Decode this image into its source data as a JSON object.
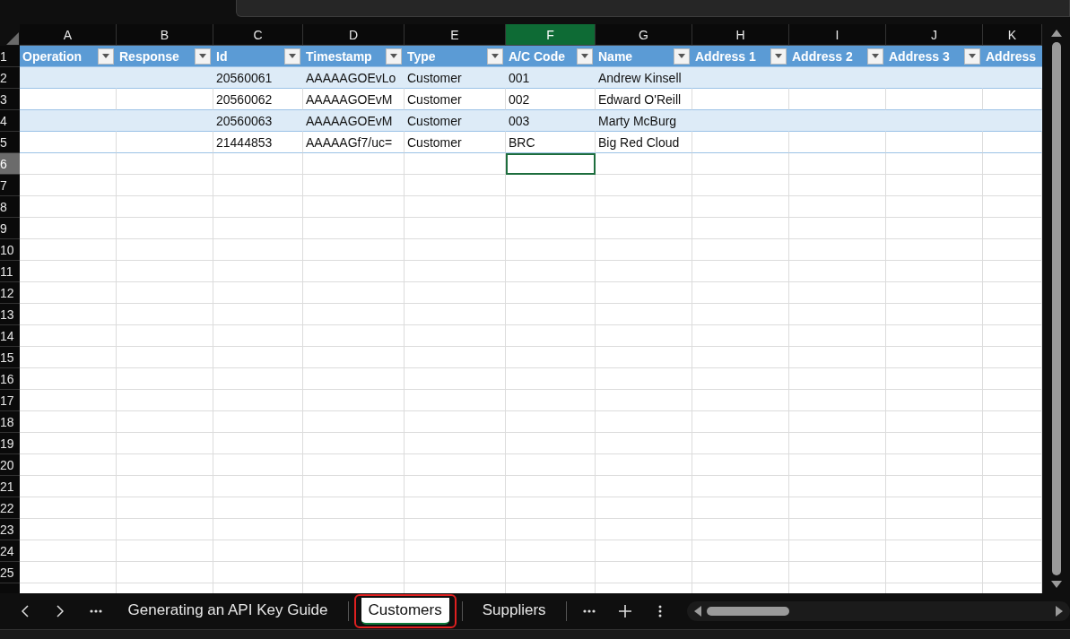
{
  "columns": [
    {
      "letter": "A",
      "selected": false
    },
    {
      "letter": "B",
      "selected": false
    },
    {
      "letter": "C",
      "selected": false
    },
    {
      "letter": "D",
      "selected": false
    },
    {
      "letter": "E",
      "selected": false
    },
    {
      "letter": "F",
      "selected": true
    },
    {
      "letter": "G",
      "selected": false
    },
    {
      "letter": "H",
      "selected": false
    },
    {
      "letter": "I",
      "selected": false
    },
    {
      "letter": "J",
      "selected": false
    },
    {
      "letter": "K",
      "selected": false
    }
  ],
  "row_headers": [
    {
      "label": "1",
      "selected": false
    },
    {
      "label": "2",
      "selected": false
    },
    {
      "label": "3",
      "selected": false
    },
    {
      "label": "4",
      "selected": false
    },
    {
      "label": "5",
      "selected": false
    },
    {
      "label": "6",
      "selected": true
    },
    {
      "label": "7",
      "selected": false
    },
    {
      "label": "8",
      "selected": false
    },
    {
      "label": "9",
      "selected": false
    },
    {
      "label": "10",
      "selected": false
    },
    {
      "label": "11",
      "selected": false
    },
    {
      "label": "12",
      "selected": false
    },
    {
      "label": "13",
      "selected": false
    },
    {
      "label": "14",
      "selected": false
    },
    {
      "label": "15",
      "selected": false
    },
    {
      "label": "16",
      "selected": false
    },
    {
      "label": "17",
      "selected": false
    },
    {
      "label": "18",
      "selected": false
    },
    {
      "label": "19",
      "selected": false
    },
    {
      "label": "20",
      "selected": false
    },
    {
      "label": "21",
      "selected": false
    },
    {
      "label": "22",
      "selected": false
    },
    {
      "label": "23",
      "selected": false
    },
    {
      "label": "24",
      "selected": false
    },
    {
      "label": "25",
      "selected": false
    }
  ],
  "table": {
    "headers": [
      {
        "label": "Operation",
        "filter_button": true
      },
      {
        "label": "Response",
        "filter_button": true
      },
      {
        "label": "Id",
        "filter_button": true
      },
      {
        "label": "Timestamp",
        "filter_button": true
      },
      {
        "label": "Type",
        "filter_button": true
      },
      {
        "label": "A/C Code",
        "filter_button": true
      },
      {
        "label": "Name",
        "filter_button": true
      },
      {
        "label": "Address 1",
        "filter_button": true
      },
      {
        "label": "Address 2",
        "filter_button": true
      },
      {
        "label": "Address 3",
        "filter_button": true
      },
      {
        "label": "Address",
        "filter_button": false
      }
    ],
    "rows": [
      {
        "cells": [
          "20560061",
          "AAAAAGOEvLo",
          "Customer",
          "001",
          "Andrew Kinsell"
        ]
      },
      {
        "cells": [
          "20560062",
          "AAAAAGOEvM",
          "Customer",
          "002",
          "Edward O'Reill"
        ]
      },
      {
        "cells": [
          "20560063",
          "AAAAAGOEvM",
          "Customer",
          "003",
          "Marty McBurg"
        ]
      },
      {
        "cells": [
          "21444853",
          "AAAAAGf7/uc=",
          "Customer",
          "BRC",
          "Big Red Cloud"
        ]
      }
    ]
  },
  "sheet_tabs": [
    {
      "label": "Generating an API Key Guide",
      "selected": false,
      "highlighted": false
    },
    {
      "label": "Customers",
      "selected": true,
      "highlighted": true
    },
    {
      "label": "Suppliers",
      "selected": false,
      "highlighted": false
    }
  ]
}
